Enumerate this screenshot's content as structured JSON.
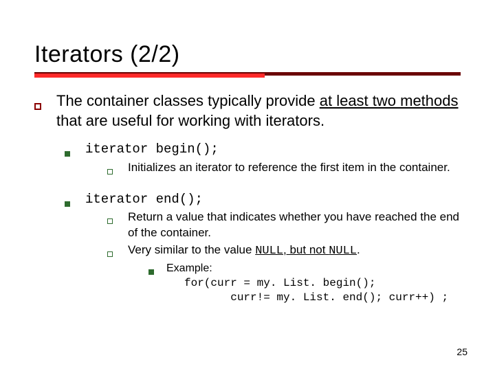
{
  "title": "Iterators (2/2)",
  "intro": {
    "pre": "The container classes typically provide ",
    "underlined": "at least two methods",
    "post": " that are useful for working with iterators."
  },
  "methods": [
    {
      "sig": "iterator begin();",
      "sub": [
        {
          "text": "Initializes an iterator to reference the first item in the container."
        }
      ]
    },
    {
      "sig": "iterator end();",
      "sub": [
        {
          "text": "Return a value that indicates whether you have reached the end of the container."
        },
        {
          "pre": "Very similar to the value ",
          "code1": "NULL",
          "mid": ", but not ",
          "code2": "NULL",
          "post": "."
        }
      ],
      "example": {
        "label": "Example:",
        "code_line1": "for(curr = my. List. begin();",
        "code_line2": "       curr!= my. List. end(); curr++) ;"
      }
    }
  ],
  "page_number": "25"
}
